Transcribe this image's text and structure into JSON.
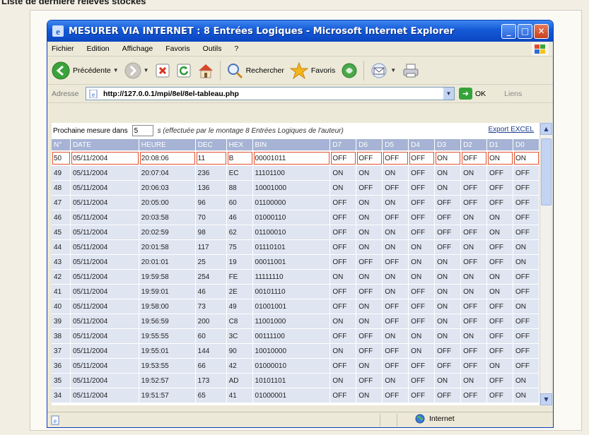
{
  "caption": "Liste de dernière relevés stockés",
  "window": {
    "title": "MESURER VIA INTERNET : 8 Entrées Logiques - Microsoft Internet Explorer",
    "controls": {
      "minimize": "_",
      "maximize": "□",
      "close": "✕"
    }
  },
  "menu": [
    "Fichier",
    "Edition",
    "Affichage",
    "Favoris",
    "Outils",
    "?"
  ],
  "toolbar": {
    "back": "Précédente",
    "search": "Rechercher",
    "favorites": "Favoris"
  },
  "address": {
    "label": "Adresse",
    "url": "http://127.0.0.1/mpi/8el/8el-tableau.php",
    "go": "OK",
    "links": "Liens"
  },
  "page": {
    "next_label": "Prochaine mesure dans",
    "seconds_value": "5",
    "note": "s (effectuée par le montage 8 Entrées Logiques de l'auteur)",
    "export": "Export EXCEL"
  },
  "table": {
    "headers": [
      "N°",
      "DATE",
      "HEURE",
      "DEC",
      "HEX",
      "BIN",
      "D7",
      "D6",
      "D5",
      "D4",
      "D3",
      "D2",
      "D1",
      "D0"
    ],
    "rows": [
      [
        "50",
        "05/11/2004",
        "20:08:06",
        "11",
        "B",
        "00001011",
        "OFF",
        "OFF",
        "OFF",
        "OFF",
        "ON",
        "OFF",
        "ON",
        "ON"
      ],
      [
        "49",
        "05/11/2004",
        "20:07:04",
        "236",
        "EC",
        "11101100",
        "ON",
        "ON",
        "ON",
        "OFF",
        "ON",
        "ON",
        "OFF",
        "OFF"
      ],
      [
        "48",
        "05/11/2004",
        "20:06:03",
        "136",
        "88",
        "10001000",
        "ON",
        "OFF",
        "OFF",
        "OFF",
        "ON",
        "OFF",
        "OFF",
        "OFF"
      ],
      [
        "47",
        "05/11/2004",
        "20:05:00",
        "96",
        "60",
        "01100000",
        "OFF",
        "ON",
        "ON",
        "OFF",
        "OFF",
        "OFF",
        "OFF",
        "OFF"
      ],
      [
        "46",
        "05/11/2004",
        "20:03:58",
        "70",
        "46",
        "01000110",
        "OFF",
        "ON",
        "OFF",
        "OFF",
        "OFF",
        "ON",
        "ON",
        "OFF"
      ],
      [
        "45",
        "05/11/2004",
        "20:02:59",
        "98",
        "62",
        "01100010",
        "OFF",
        "ON",
        "ON",
        "OFF",
        "OFF",
        "OFF",
        "ON",
        "OFF"
      ],
      [
        "44",
        "05/11/2004",
        "20:01:58",
        "117",
        "75",
        "01110101",
        "OFF",
        "ON",
        "ON",
        "ON",
        "OFF",
        "ON",
        "OFF",
        "ON"
      ],
      [
        "43",
        "05/11/2004",
        "20:01:01",
        "25",
        "19",
        "00011001",
        "OFF",
        "OFF",
        "OFF",
        "ON",
        "ON",
        "OFF",
        "OFF",
        "ON"
      ],
      [
        "42",
        "05/11/2004",
        "19:59:58",
        "254",
        "FE",
        "11111110",
        "ON",
        "ON",
        "ON",
        "ON",
        "ON",
        "ON",
        "ON",
        "OFF"
      ],
      [
        "41",
        "05/11/2004",
        "19:59:01",
        "46",
        "2E",
        "00101110",
        "OFF",
        "OFF",
        "ON",
        "OFF",
        "ON",
        "ON",
        "ON",
        "OFF"
      ],
      [
        "40",
        "05/11/2004",
        "19:58:00",
        "73",
        "49",
        "01001001",
        "OFF",
        "ON",
        "OFF",
        "OFF",
        "ON",
        "OFF",
        "OFF",
        "ON"
      ],
      [
        "39",
        "05/11/2004",
        "19:56:59",
        "200",
        "C8",
        "11001000",
        "ON",
        "ON",
        "OFF",
        "OFF",
        "ON",
        "OFF",
        "OFF",
        "OFF"
      ],
      [
        "38",
        "05/11/2004",
        "19:55:55",
        "60",
        "3C",
        "00111100",
        "OFF",
        "OFF",
        "ON",
        "ON",
        "ON",
        "ON",
        "OFF",
        "OFF"
      ],
      [
        "37",
        "05/11/2004",
        "19:55:01",
        "144",
        "90",
        "10010000",
        "ON",
        "OFF",
        "OFF",
        "ON",
        "OFF",
        "OFF",
        "OFF",
        "OFF"
      ],
      [
        "36",
        "05/11/2004",
        "19:53:55",
        "66",
        "42",
        "01000010",
        "OFF",
        "ON",
        "OFF",
        "OFF",
        "OFF",
        "OFF",
        "ON",
        "OFF"
      ],
      [
        "35",
        "05/11/2004",
        "19:52:57",
        "173",
        "AD",
        "10101101",
        "ON",
        "OFF",
        "ON",
        "OFF",
        "ON",
        "ON",
        "OFF",
        "ON"
      ],
      [
        "34",
        "05/11/2004",
        "19:51:57",
        "65",
        "41",
        "01000001",
        "OFF",
        "ON",
        "OFF",
        "OFF",
        "OFF",
        "OFF",
        "OFF",
        "ON"
      ]
    ]
  },
  "status": {
    "zone": "Internet"
  },
  "colors": {
    "titlebar": "#1459d6",
    "header": "#a6b3d4",
    "row": "#dfe5f1",
    "highlight": "#e2502c"
  }
}
